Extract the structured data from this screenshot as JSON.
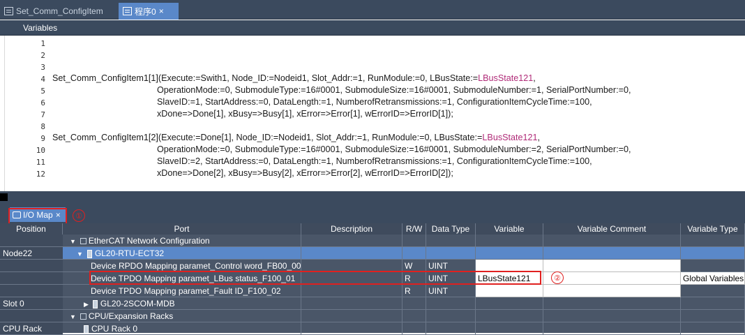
{
  "doc_tabs": [
    {
      "label": "Set_Comm_ConfigItem",
      "active": false
    },
    {
      "label": "程序0",
      "active": true,
      "close": "×"
    }
  ],
  "variables_label": "Variables",
  "code_lines": [
    {
      "n": "1",
      "text": ""
    },
    {
      "n": "2",
      "text": ""
    },
    {
      "n": "3",
      "text": ""
    },
    {
      "n": "4",
      "pre": "Set_Comm_ConfigItem1[1](Execute:=Swith1, Node_ID:=Nodeid1, Slot_Addr:=1, RunModule:=0, LBusState:=",
      "kw": "LBusState121",
      "post": ","
    },
    {
      "n": "5",
      "text": "OperationMode:=0, SubmoduleType:=16#0001, SubmoduleSize:=16#0001, SubmoduleNumber:=1, SerialPortNumber:=0,"
    },
    {
      "n": "6",
      "text": "SlaveID:=1, StartAddress:=0, DataLength:=1, NumberofRetransmissions:=1, ConfigurationItemCycleTime:=100,"
    },
    {
      "n": "7",
      "text": "xDone=>Done[1], xBusy=>Busy[1], xError=>Error[1], wErrorID=>ErrorID[1]);"
    },
    {
      "n": "8",
      "text": ""
    },
    {
      "n": "9",
      "pre": "Set_Comm_ConfigItem1[2](Execute:=Done[1], Node_ID:=Nodeid1, Slot_Addr:=1, RunModule:=0, LBusState:=",
      "kw": "LBusState121",
      "post": ","
    },
    {
      "n": "10",
      "text": "OperationMode:=0, SubmoduleType:=16#0001, SubmoduleSize:=16#0001, SubmoduleNumber:=2, SerialPortNumber:=0,"
    },
    {
      "n": "11",
      "text": "SlaveID:=2, StartAddress:=0, DataLength:=1, NumberofRetransmissions:=1, ConfigurationItemCycleTime:=100,"
    },
    {
      "n": "12",
      "text": "xDone=>Done[2], xBusy=>Busy[2], xError=>Error[2], wErrorID=>ErrorID[2]);"
    }
  ],
  "io_tab": {
    "label": "I/O Map",
    "close": "×"
  },
  "markers": {
    "one": "①",
    "two": "②"
  },
  "columns": [
    "Position",
    "Port",
    "Description",
    "R/W",
    "Data Type",
    "Variable",
    "Variable Comment",
    "Variable Type"
  ],
  "rows": [
    {
      "position": "",
      "port": "EtherCAT Network Configuration",
      "rw": "",
      "type": "",
      "variable": "",
      "comment": "",
      "vartype": ""
    },
    {
      "position": "Node22",
      "port": "GL20-RTU-ECT32",
      "rw": "",
      "type": "",
      "variable": "",
      "comment": "",
      "vartype": ""
    },
    {
      "position": "",
      "port": "Device RPDO Mapping paramet_Control word_FB00_00",
      "rw": "W",
      "type": "UINT",
      "variable": "",
      "comment": "",
      "vartype": ""
    },
    {
      "position": "",
      "port": "Device TPDO Mapping paramet_LBus status_F100_01",
      "rw": "R",
      "type": "UINT",
      "variable": "LBusState121",
      "comment": "",
      "vartype": "Global Variables"
    },
    {
      "position": "",
      "port": "Device TPDO Mapping paramet_Fault ID_F100_02",
      "rw": "R",
      "type": "UINT",
      "variable": "",
      "comment": "",
      "vartype": ""
    },
    {
      "position": "Slot 0",
      "port": "GL20-2SCOM-MDB",
      "rw": "",
      "type": "",
      "variable": "",
      "comment": "",
      "vartype": ""
    },
    {
      "position": "",
      "port": "CPU/Expansion Racks",
      "rw": "",
      "type": "",
      "variable": "",
      "comment": "",
      "vartype": ""
    },
    {
      "position": "CPU Rack",
      "port": "CPU Rack 0",
      "rw": "",
      "type": "",
      "variable": "",
      "comment": "",
      "vartype": ""
    }
  ],
  "colors": {
    "accent": "#5a88c9",
    "panel": "#3b4a5e",
    "highlight": "#e0201f",
    "keyword": "#b02b78"
  }
}
